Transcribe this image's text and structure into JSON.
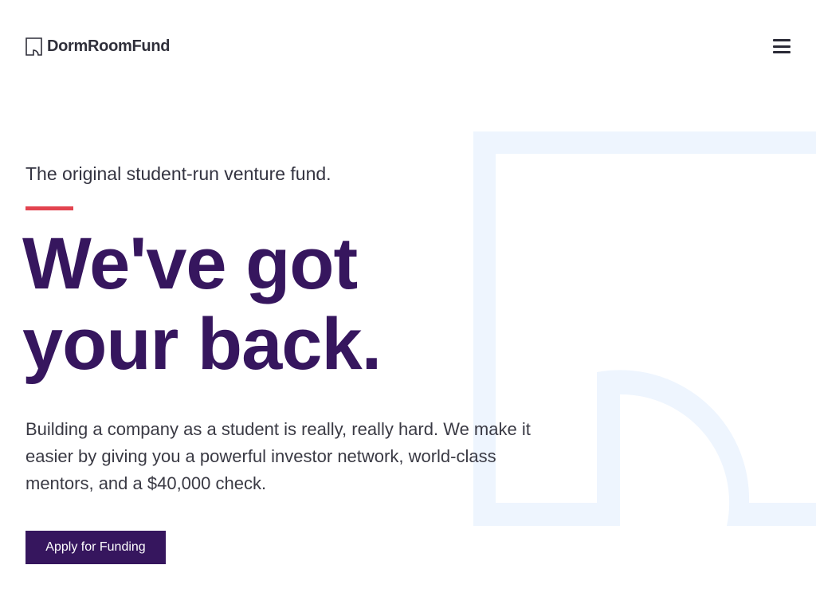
{
  "brand": {
    "name": "DormRoomFund",
    "logo_icon": "dorm-room-fund-logo-icon"
  },
  "nav": {
    "menu_icon": "hamburger-menu-icon"
  },
  "hero": {
    "tagline": "The original student-run venture fund.",
    "headline_line1": "We've got",
    "headline_line2": "your back.",
    "description": "Building a company as a student is really, really hard. We make it easier by giving you a powerful investor network, world-class mentors, and a $40,000 check.",
    "cta_label": "Apply for Funding"
  },
  "colors": {
    "primary": "#36165e",
    "accent": "#e2434f",
    "background_mark": "#eef5fe",
    "text": "#3a3a44"
  }
}
